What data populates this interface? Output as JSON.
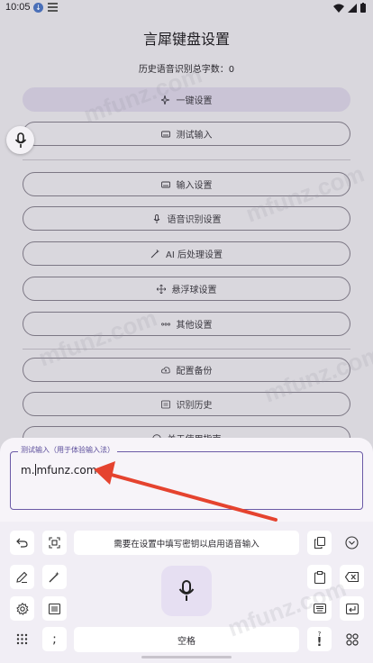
{
  "status_bar": {
    "time": "10:05"
  },
  "page": {
    "title": "言犀键盘设置",
    "history_count": "历史语音识别总字数：0",
    "buttons": [
      {
        "label": "一键设置",
        "icon": "sparkle-icon"
      },
      {
        "label": "测试输入",
        "icon": "keyboard-icon"
      },
      {
        "label": "输入设置",
        "icon": "keyboard-icon"
      },
      {
        "label": "语音识别设置",
        "icon": "mic-icon"
      },
      {
        "label": "AI 后处理设置",
        "icon": "magic-wand-icon"
      },
      {
        "label": "悬浮球设置",
        "icon": "move-icon"
      },
      {
        "label": "其他设置",
        "icon": "more-icon"
      },
      {
        "label": "配置备份",
        "icon": "cloud-upload-icon"
      },
      {
        "label": "识别历史",
        "icon": "history-icon"
      },
      {
        "label": "关于使用指南",
        "icon": "info-icon"
      }
    ]
  },
  "test_field": {
    "label": "测试输入（用于体验输入法）",
    "value_before_cursor": "m.",
    "value_after_cursor": "mfunz.com"
  },
  "keyboard": {
    "notice": "需要在设置中填写密钥以启用语音输入",
    "space_label": "空格",
    "comma": ";",
    "exclaim": "!",
    "exclaim_top": "?"
  },
  "watermark": "mfunz.com",
  "colors": {
    "accent": "#6b5aa6",
    "annotation_arrow": "#e5432f"
  }
}
